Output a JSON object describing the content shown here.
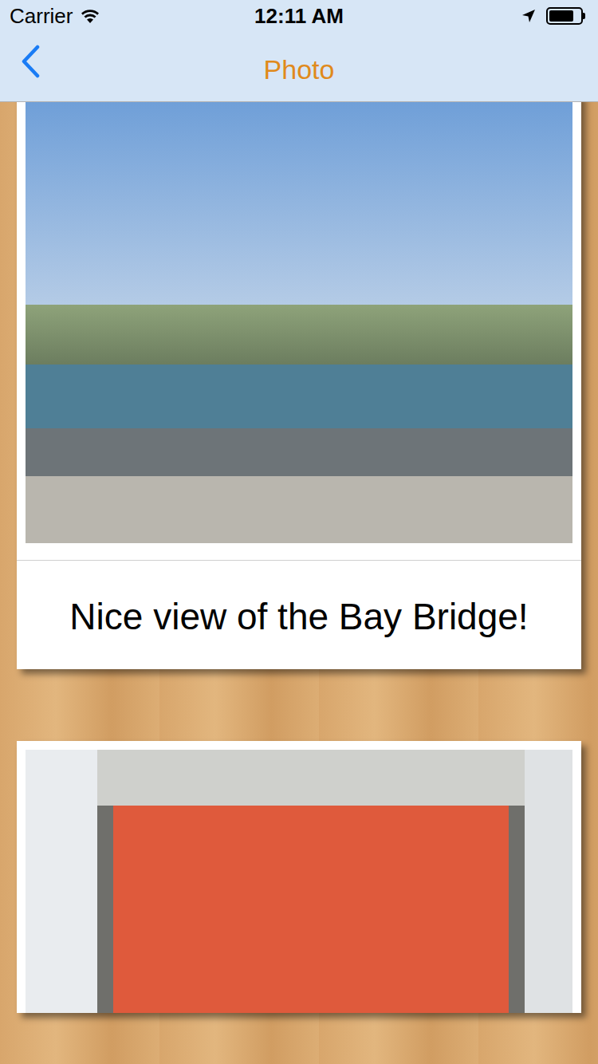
{
  "status_bar": {
    "carrier": "Carrier",
    "time": "12:11 AM",
    "battery": {
      "level": 0.8
    }
  },
  "nav_bar": {
    "title": "Photo"
  },
  "posts": [
    {
      "caption": "Nice view of the Bay Bridge!",
      "photo": "bridge"
    },
    {
      "photo": "sign"
    }
  ]
}
